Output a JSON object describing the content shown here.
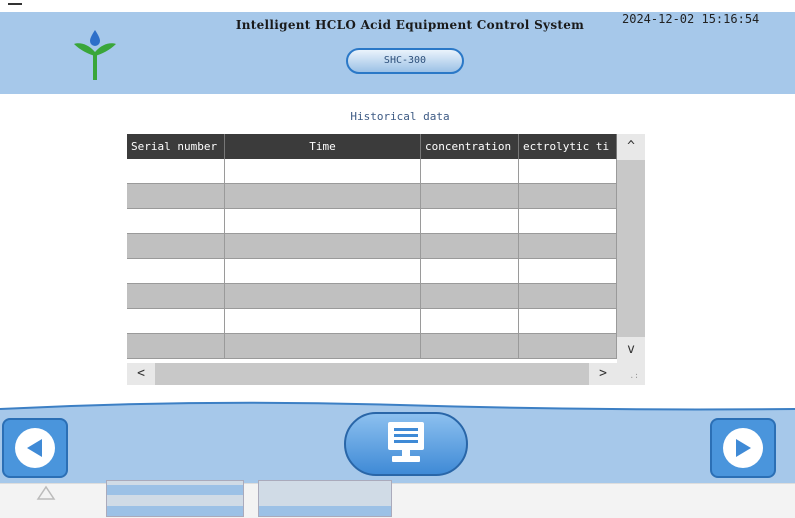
{
  "header": {
    "title": "Intelligent HCLO Acid Equipment Control System",
    "model": "SHC-300",
    "datetime": "2024-12-02 15:16:54"
  },
  "content": {
    "section_title": "Historical data",
    "table": {
      "columns": [
        "Serial number",
        "Time",
        "concentration",
        "ectrolytic ti"
      ],
      "rows": [
        [
          "",
          "",
          "",
          ""
        ],
        [
          "",
          "",
          "",
          ""
        ],
        [
          "",
          "",
          "",
          ""
        ],
        [
          "",
          "",
          "",
          ""
        ],
        [
          "",
          "",
          "",
          ""
        ],
        [
          "",
          "",
          "",
          ""
        ],
        [
          "",
          "",
          "",
          ""
        ],
        [
          "",
          "",
          "",
          ""
        ]
      ]
    }
  },
  "scrollbars": {
    "up": "^",
    "down": "v",
    "left": "<",
    "right": ">"
  },
  "footer": {
    "prev_icon": "left-arrow-icon",
    "home_icon": "monitor-icon",
    "next_icon": "right-arrow-icon"
  },
  "colors": {
    "header_bg": "#a6c8ea",
    "accent": "#4a95dc",
    "table_header": "#3b3b3b",
    "row_alt": "#c0c0c0"
  }
}
